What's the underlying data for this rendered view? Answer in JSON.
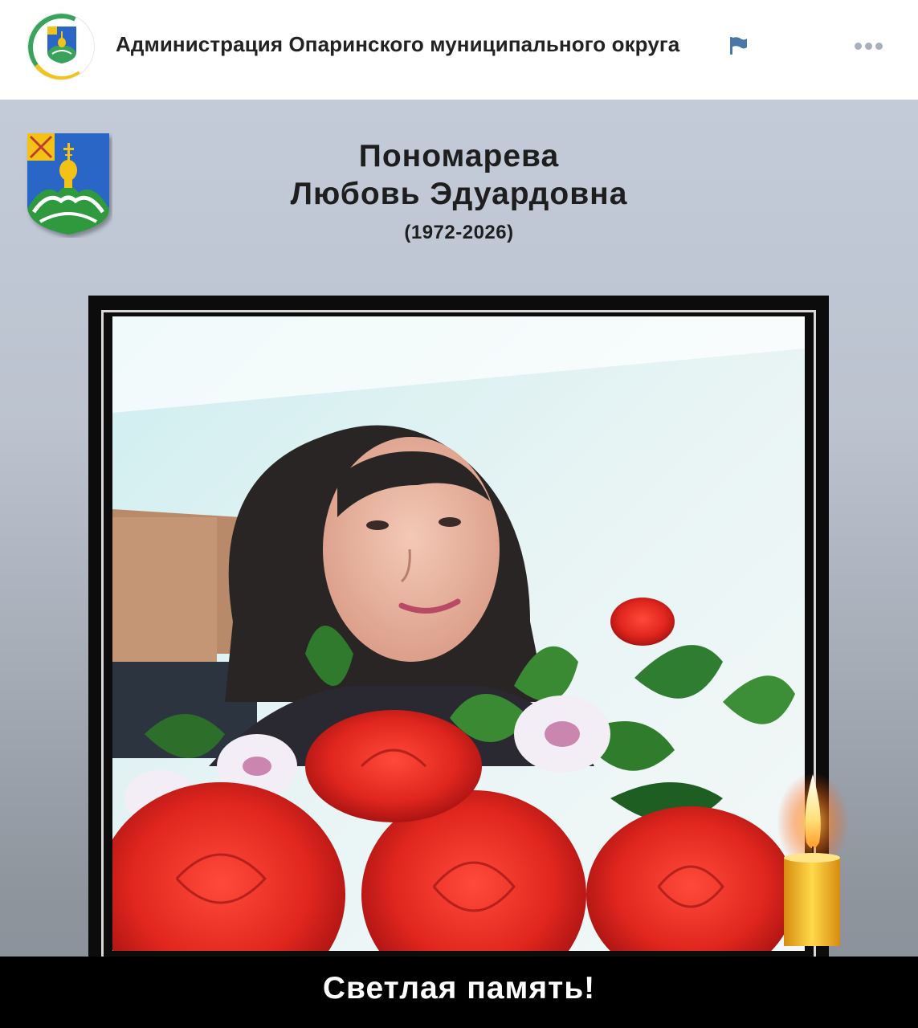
{
  "header": {
    "group_name": "Администрация Опаринского муниципального округа",
    "flag_color": "#4a76a8",
    "avatar_icon": "coat-of-arms-avatar-icon",
    "more_icon": "more-horizontal-icon"
  },
  "post": {
    "surname": "Пономарева",
    "first_name": "Любовь Эдуардовна",
    "years": "(1972-2026)",
    "memory_text": "Светлая память!",
    "coat_icon": "coat-of-arms-icon",
    "photo_icon": "portrait-photo",
    "candle_icon": "candle-icon"
  },
  "colors": {
    "accent_green": "#3aa35b",
    "accent_yellow": "#f2c318",
    "coat_blue": "#2a66c6",
    "frame_black": "#0c0c0c"
  }
}
